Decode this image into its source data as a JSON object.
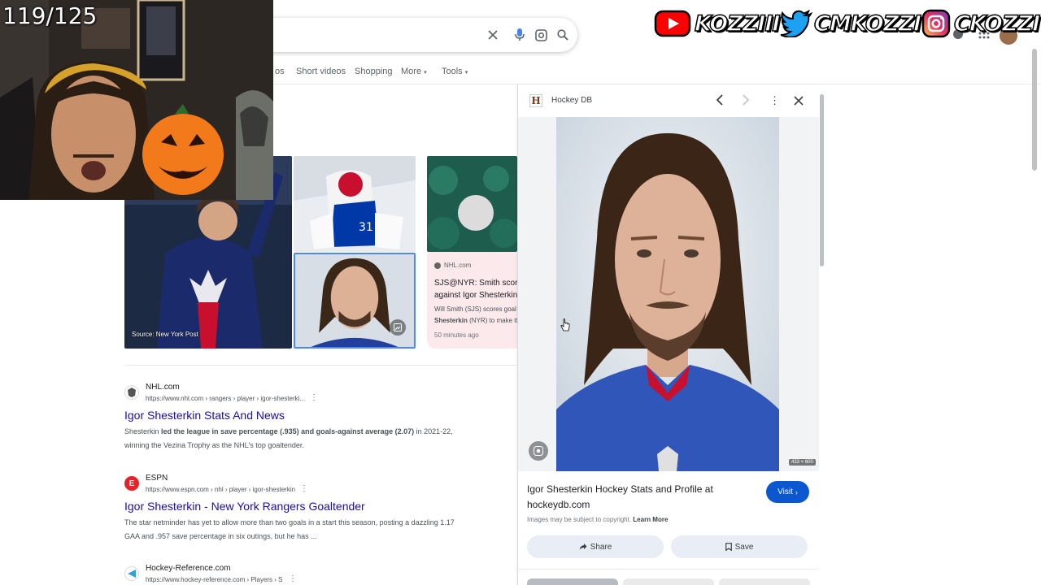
{
  "stream": {
    "counter": "119/125",
    "social": [
      {
        "platform": "youtube",
        "handle": "KOZZIII",
        "color": "#ff0000"
      },
      {
        "platform": "twitter",
        "handle": "CMKOZZI",
        "color": "#1da1f2"
      },
      {
        "platform": "instagram",
        "handle": "CKOZZI",
        "color": "#c13584"
      }
    ]
  },
  "tabs": [
    {
      "label": "os"
    },
    {
      "label": "Short videos"
    },
    {
      "label": "Shopping"
    },
    {
      "label": "More"
    },
    {
      "label": "Tools"
    }
  ],
  "image_grid": {
    "source_caption": "Source: New York Post",
    "card": {
      "site": "NHL.com",
      "title_line1": "SJS@NYR: Smith scores",
      "title_line2": "against Igor Shesterkin |",
      "snippet_line1": "Will Smith (SJS) scores goal",
      "snippet_bold": "Shesterkin",
      "snippet_line2_rest": "(NYR) to make it",
      "time": "50 minutes ago"
    }
  },
  "results": [
    {
      "site": "NHL.com",
      "url": "https://www.nhl.com › rangers › player › igor-shesterki...",
      "title": "Igor Shesterkin Stats And News",
      "snippet_line1_a": "Shesterkin ",
      "snippet_line1_b": "led the league in save percentage (.935) and goals-against average (2.07)",
      "snippet_line1_c": " in 2021-22,",
      "snippet_line2": "winning the Vezina Trophy as the NHL's top goaltender.",
      "favicon_color": "#555555"
    },
    {
      "site": "ESPN",
      "url": "https://www.espn.com › nhl › player › igor-shesterkin",
      "title": "Igor Shesterkin - New York Rangers Goaltender",
      "snippet_line1": "The star netminder has yet to allow more than two goals in a start this season, posting a dazzling 1.17",
      "snippet_line2": "GAA and .957 save percentage in six outings, but he has ...",
      "favicon_color": "#e8222a"
    },
    {
      "site": "Hockey-Reference.com",
      "url": "https://www.hockey-reference.com › Players › S",
      "favicon_color": "#2ea3d8"
    }
  ],
  "panel": {
    "source_name": "Hockey DB",
    "image_dims": "433 × 600",
    "title_line1": "Igor Shesterkin Hockey Stats and Profile at",
    "title_line2": "hockeydb.com",
    "visit_label": "Visit",
    "copyright": "Images may be subject to copyright.",
    "learn_more": "Learn More",
    "share_label": "Share",
    "save_label": "Save"
  },
  "colors": {
    "link_blue": "#1a0dab",
    "google_blue": "#0b57d0",
    "card_pink": "#fbe9ec"
  }
}
